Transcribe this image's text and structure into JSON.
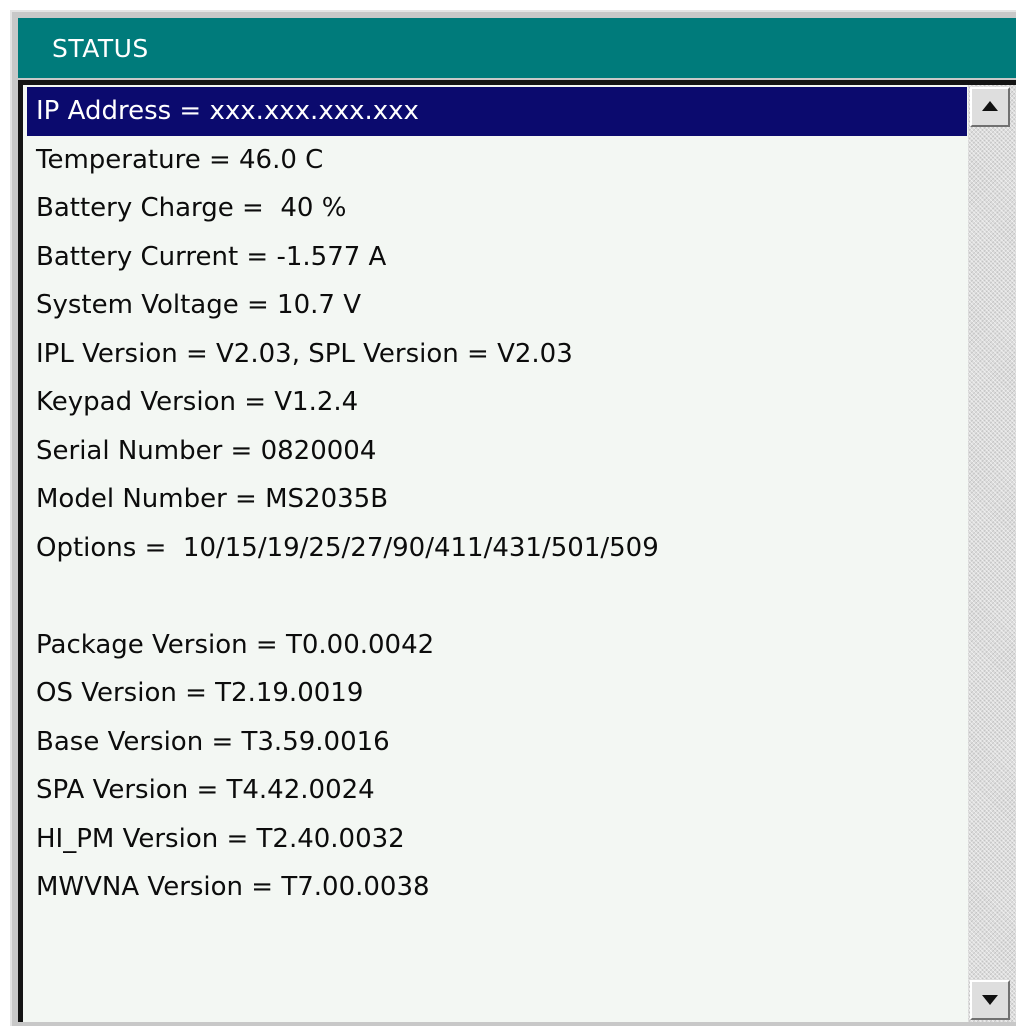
{
  "panel": {
    "title": "STATUS"
  },
  "status_list": {
    "items": [
      {
        "label": "IP Address = xxx.xxx.xxx.xxx",
        "selected": true
      },
      {
        "label": "Temperature = 46.0 C",
        "selected": false
      },
      {
        "label": "Battery Charge =  40 %",
        "selected": false
      },
      {
        "label": "Battery Current = -1.577 A",
        "selected": false
      },
      {
        "label": "System Voltage = 10.7 V",
        "selected": false
      },
      {
        "label": "IPL Version = V2.03, SPL Version = V2.03",
        "selected": false
      },
      {
        "label": "Keypad Version = V1.2.4",
        "selected": false
      },
      {
        "label": "Serial Number = 0820004",
        "selected": false
      },
      {
        "label": "Model Number = MS2035B",
        "selected": false
      },
      {
        "label": "Options =  10/15/19/25/27/90/411/431/501/509",
        "selected": false
      },
      {
        "label": "",
        "selected": false
      },
      {
        "label": "Package Version = T0.00.0042",
        "selected": false
      },
      {
        "label": "OS Version = T2.19.0019",
        "selected": false
      },
      {
        "label": "Base Version = T3.59.0016",
        "selected": false
      },
      {
        "label": "SPA Version = T4.42.0024",
        "selected": false
      },
      {
        "label": "HI_PM Version = T2.40.0032",
        "selected": false
      },
      {
        "label": "MWVNA Version = T7.00.0038",
        "selected": false
      }
    ]
  },
  "scrollbar": {
    "up_icon": "arrow-up-icon",
    "down_icon": "arrow-down-icon"
  },
  "colors": {
    "title_bar": "#007b7b",
    "selection": "#0b0a6e",
    "list_background": "#f3f7f3"
  }
}
